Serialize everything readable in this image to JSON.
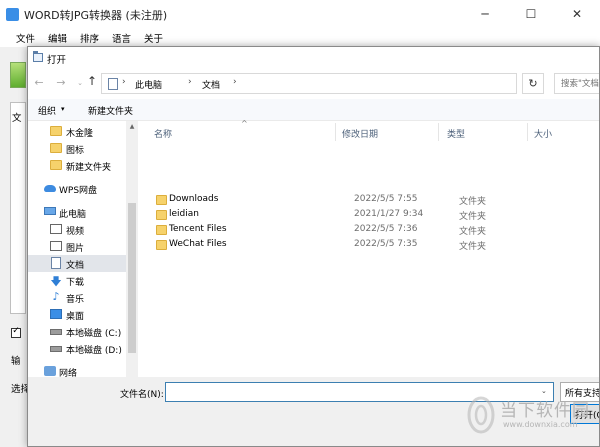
{
  "app": {
    "title": "WORD转JPG转换器 (未注册)",
    "min_glyph": "─",
    "max_glyph": "☐",
    "close_glyph": "✕",
    "menu": [
      "文件",
      "编辑",
      "排序",
      "语言",
      "关于"
    ],
    "list_label": "文",
    "checkbox_glyph": "✓",
    "output_label": "输",
    "select_label": "选择"
  },
  "dialog": {
    "title": "打开",
    "nav": {
      "back_glyph": "←",
      "forward_glyph": "→",
      "recent_glyph": "⌄",
      "up_glyph": "↑"
    },
    "address": {
      "crumbs": [
        "此电脑",
        "文档"
      ],
      "separator": "›",
      "dropdown_glyph": "⌄"
    },
    "refresh_glyph": "↻",
    "search_placeholder": "搜索\"文档\"",
    "toolbar": {
      "organize": "组织",
      "organize_arrow": "▾",
      "new_folder": "新建文件夹"
    },
    "nav_pane": [
      {
        "label": "木金隆",
        "icon": "folder-icon"
      },
      {
        "label": "图标",
        "icon": "folder-icon"
      },
      {
        "label": "新建文件夹",
        "icon": "folder-icon"
      },
      {
        "label": "WPS网盘",
        "icon": "cloud-icon"
      },
      {
        "label": "此电脑",
        "icon": "computer-icon"
      },
      {
        "label": "视频",
        "icon": "video-icon"
      },
      {
        "label": "图片",
        "icon": "picture-icon"
      },
      {
        "label": "文档",
        "icon": "document-icon"
      },
      {
        "label": "下载",
        "icon": "download-icon"
      },
      {
        "label": "音乐",
        "icon": "music-icon"
      },
      {
        "label": "桌面",
        "icon": "desktop-icon"
      },
      {
        "label": "本地磁盘 (C:)",
        "icon": "drive-icon"
      },
      {
        "label": "本地磁盘 (D:)",
        "icon": "drive-icon"
      },
      {
        "label": "网络",
        "icon": "network-icon"
      }
    ],
    "glyphs": {
      "download": "🡇",
      "music": "♪",
      "scroll_up": "▲",
      "sort_up": "^"
    },
    "columns": [
      "名称",
      "修改日期",
      "类型",
      "大小"
    ],
    "files": [
      {
        "name": "Downloads",
        "date": "2022/5/5 7:55",
        "type": "文件夹"
      },
      {
        "name": "leidian",
        "date": "2021/1/27 9:34",
        "type": "文件夹"
      },
      {
        "name": "Tencent Files",
        "date": "2022/5/5 7:36",
        "type": "文件夹"
      },
      {
        "name": "WeChat Files",
        "date": "2022/5/5 7:35",
        "type": "文件夹"
      }
    ],
    "filename_label": "文件名(N):",
    "filename_value": "",
    "filename_dropdown_glyph": "⌄",
    "filter_label": "所有支持",
    "open_label": "打开(O"
  },
  "watermark": {
    "main": "当下软件园",
    "sub": "www.downxia.com"
  }
}
